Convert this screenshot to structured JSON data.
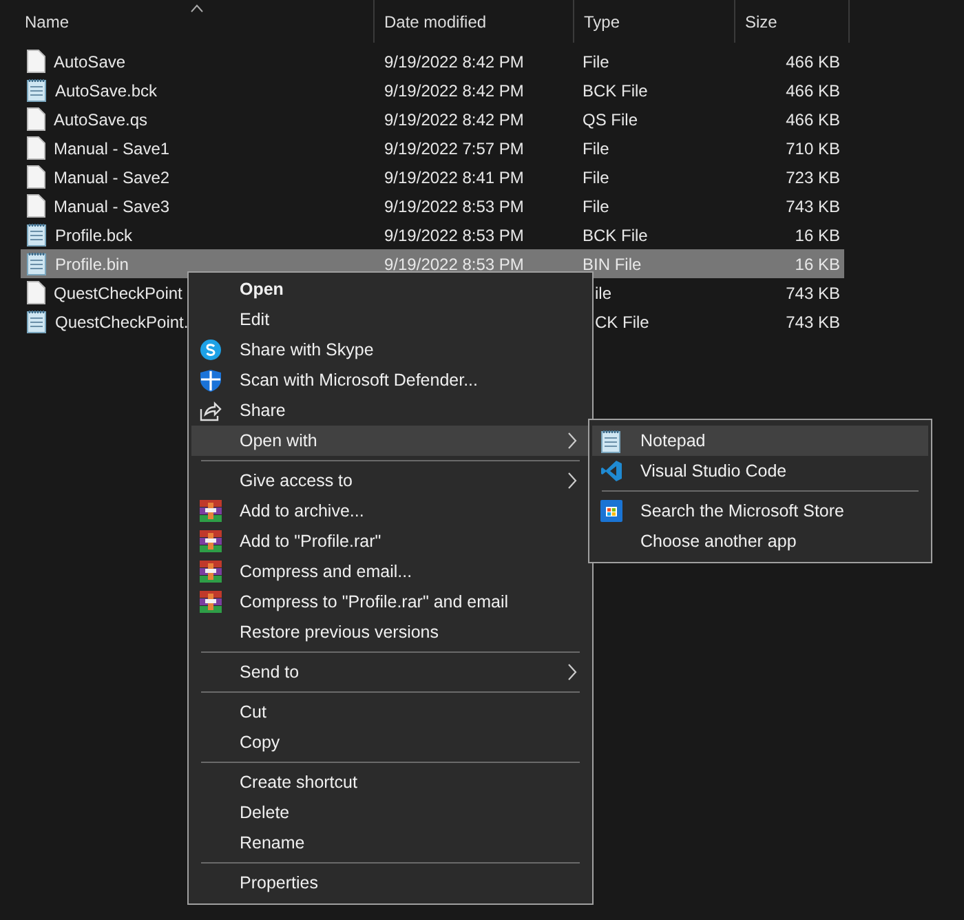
{
  "columns": [
    {
      "label": "Name",
      "sorted": true
    },
    {
      "label": "Date modified",
      "sorted": false
    },
    {
      "label": "Type",
      "sorted": false
    },
    {
      "label": "Size",
      "sorted": false
    }
  ],
  "files": [
    {
      "kind": "plain",
      "name": "AutoSave",
      "date": "9/19/2022 8:42 PM",
      "type": "File",
      "size": "466 KB",
      "selected": false
    },
    {
      "kind": "notepad",
      "name": "AutoSave.bck",
      "date": "9/19/2022 8:42 PM",
      "type": "BCK File",
      "size": "466 KB",
      "selected": false
    },
    {
      "kind": "plain",
      "name": "AutoSave.qs",
      "date": "9/19/2022 8:42 PM",
      "type": "QS File",
      "size": "466 KB",
      "selected": false
    },
    {
      "kind": "plain",
      "name": "Manual - Save1",
      "date": "9/19/2022 7:57 PM",
      "type": "File",
      "size": "710 KB",
      "selected": false
    },
    {
      "kind": "plain",
      "name": "Manual - Save2",
      "date": "9/19/2022 8:41 PM",
      "type": "File",
      "size": "723 KB",
      "selected": false
    },
    {
      "kind": "plain",
      "name": "Manual - Save3",
      "date": "9/19/2022 8:53 PM",
      "type": "File",
      "size": "743 KB",
      "selected": false
    },
    {
      "kind": "notepad",
      "name": "Profile.bck",
      "date": "9/19/2022 8:53 PM",
      "type": "BCK File",
      "size": "16 KB",
      "selected": false
    },
    {
      "kind": "notepad",
      "name": "Profile.bin",
      "date": "9/19/2022 8:53 PM",
      "type": "BIN File",
      "size": "16 KB",
      "selected": true
    },
    {
      "kind": "plain",
      "name": "QuestCheckPoint",
      "type": "ile",
      "size": "743 KB",
      "selected": false,
      "partly_covered": true
    },
    {
      "kind": "notepad",
      "name": "QuestCheckPoint.",
      "type": "CK File",
      "size": "743 KB",
      "selected": false,
      "partly_covered": true
    }
  ],
  "context_menu": {
    "items": [
      {
        "kind": "plain",
        "label": "Open",
        "default": true,
        "highlighted": false,
        "has_submenu": false
      },
      {
        "kind": "plain",
        "label": "Edit",
        "default": false,
        "highlighted": false,
        "has_submenu": false
      },
      {
        "kind": "skype",
        "label": "Share with Skype",
        "default": false,
        "highlighted": false,
        "has_submenu": false
      },
      {
        "kind": "defender",
        "label": "Scan with Microsoft Defender...",
        "default": false,
        "highlighted": false,
        "has_submenu": false
      },
      {
        "kind": "share",
        "label": "Share",
        "default": false,
        "highlighted": false,
        "has_submenu": false
      },
      {
        "kind": "plain",
        "label": "Open with",
        "default": false,
        "highlighted": true,
        "has_submenu": true
      },
      {
        "kind": "separator"
      },
      {
        "kind": "plain",
        "label": "Give access to",
        "default": false,
        "highlighted": false,
        "has_submenu": true
      },
      {
        "kind": "archive",
        "label": "Add to archive...",
        "default": false,
        "highlighted": false,
        "has_submenu": false
      },
      {
        "kind": "archive",
        "label": "Add to \"Profile.rar\"",
        "default": false,
        "highlighted": false,
        "has_submenu": false
      },
      {
        "kind": "archive",
        "label": "Compress and email...",
        "default": false,
        "highlighted": false,
        "has_submenu": false
      },
      {
        "kind": "archive",
        "label": "Compress to \"Profile.rar\" and email",
        "default": false,
        "highlighted": false,
        "has_submenu": false
      },
      {
        "kind": "plain",
        "label": "Restore previous versions",
        "default": false,
        "highlighted": false,
        "has_submenu": false
      },
      {
        "kind": "separator"
      },
      {
        "kind": "plain",
        "label": "Send to",
        "default": false,
        "highlighted": false,
        "has_submenu": true
      },
      {
        "kind": "separator"
      },
      {
        "kind": "plain",
        "label": "Cut",
        "default": false,
        "highlighted": false,
        "has_submenu": false
      },
      {
        "kind": "plain",
        "label": "Copy",
        "default": false,
        "highlighted": false,
        "has_submenu": false
      },
      {
        "kind": "separator"
      },
      {
        "kind": "plain",
        "label": "Create shortcut",
        "default": false,
        "highlighted": false,
        "has_submenu": false
      },
      {
        "kind": "plain",
        "label": "Delete",
        "default": false,
        "highlighted": false,
        "has_submenu": false
      },
      {
        "kind": "plain",
        "label": "Rename",
        "default": false,
        "highlighted": false,
        "has_submenu": false
      },
      {
        "kind": "separator"
      },
      {
        "kind": "plain",
        "label": "Properties",
        "default": false,
        "highlighted": false,
        "has_submenu": false
      }
    ]
  },
  "open_with_menu": {
    "items": [
      {
        "kind": "notepad",
        "label": "Notepad",
        "highlighted": true
      },
      {
        "kind": "vscode",
        "label": "Visual Studio Code",
        "highlighted": false
      },
      {
        "kind": "separator"
      },
      {
        "kind": "store",
        "label": "Search the Microsoft Store",
        "highlighted": false
      },
      {
        "kind": "plain",
        "label": "Choose another app",
        "highlighted": false
      }
    ]
  }
}
